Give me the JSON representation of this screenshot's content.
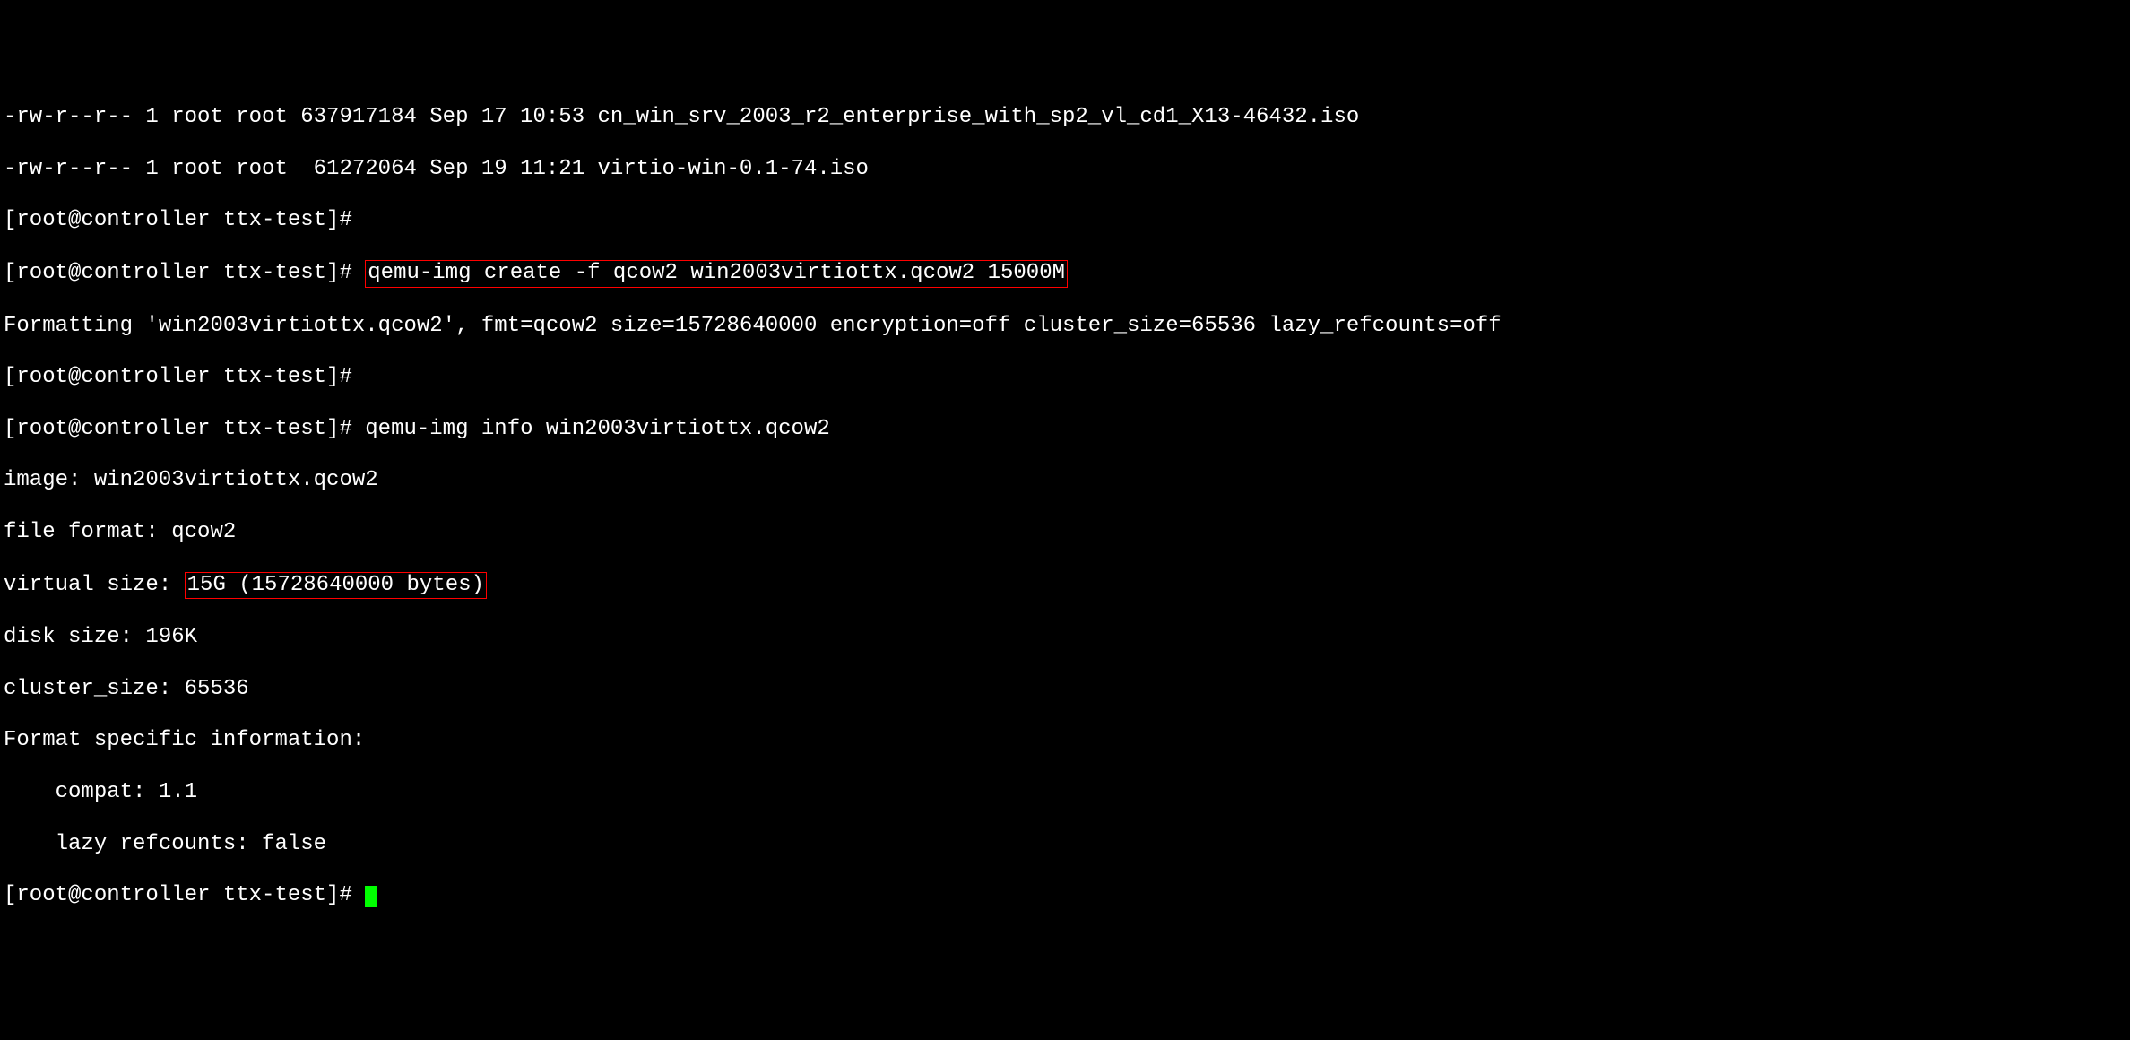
{
  "lines": {
    "l1": "-rw-r--r-- 1 root root 637917184 Sep 17 10:53 cn_win_srv_2003_r2_enterprise_with_sp2_vl_cd1_X13-46432.iso",
    "l2": "-rw-r--r-- 1 root root  61272064 Sep 19 11:21 virtio-win-0.1-74.iso",
    "l3_prompt": "[root@controller ttx-test]#",
    "l4_prompt": "[root@controller ttx-test]# ",
    "l4_cmd": "qemu-img create -f qcow2 win2003virtiottx.qcow2 15000M",
    "l5": "Formatting 'win2003virtiottx.qcow2', fmt=qcow2 size=15728640000 encryption=off cluster_size=65536 lazy_refcounts=off",
    "l6_prompt": "[root@controller ttx-test]#",
    "l7_prompt": "[root@controller ttx-test]# ",
    "l7_cmd": "qemu-img info win2003virtiottx.qcow2",
    "l8": "image: win2003virtiottx.qcow2",
    "l9": "file format: qcow2",
    "l10_prefix": "virtual size: ",
    "l10_highlight": "15G (15728640000 bytes)",
    "l11": "disk size: 196K",
    "l12": "cluster_size: 65536",
    "l13": "Format specific information:",
    "l14": "    compat: 1.1",
    "l15": "    lazy refcounts: false",
    "l16_prompt": "[root@controller ttx-test]# "
  }
}
